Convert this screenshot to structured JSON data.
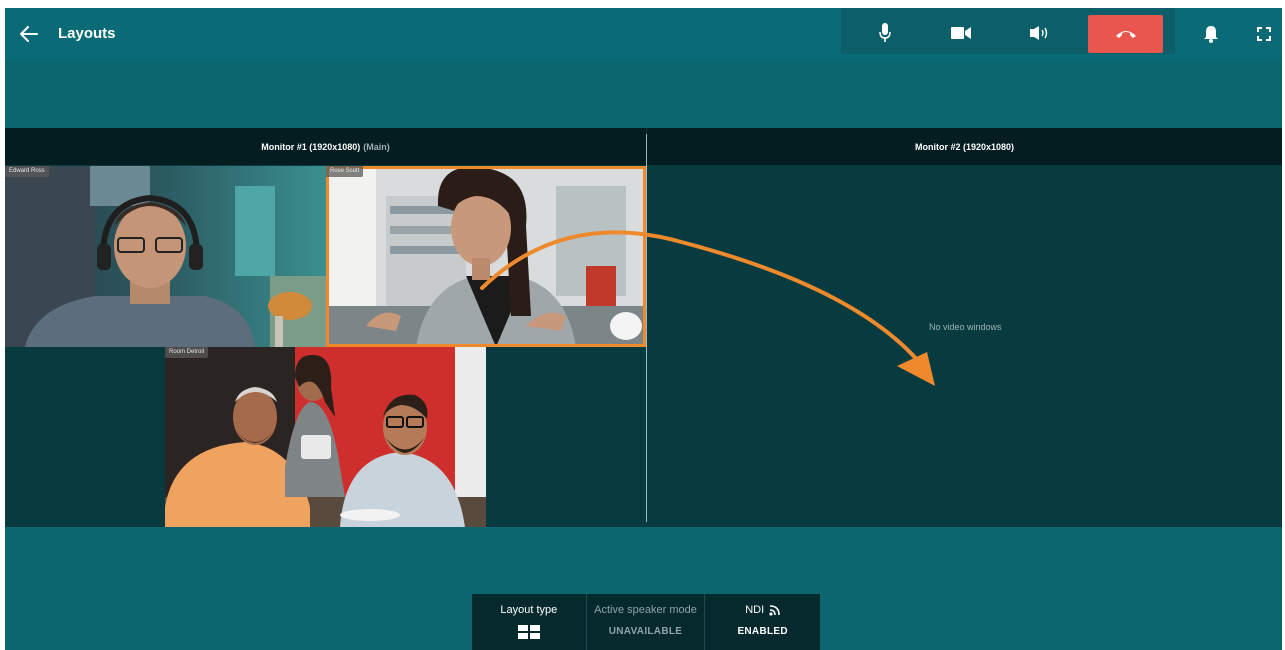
{
  "header": {
    "title": "Layouts",
    "back_icon": "arrow-left-icon"
  },
  "call_controls": {
    "icons": [
      "microphone-icon",
      "camera-icon",
      "speaker-icon",
      "hang-up-icon"
    ],
    "hangup_color": "#e8564e"
  },
  "top_icons": [
    "bell-icon",
    "fullscreen-icon"
  ],
  "monitors": [
    {
      "label": "Monitor #1 (1920x1080)",
      "suffix": "(Main)"
    },
    {
      "label": "Monitor #2 (1920x1080)",
      "suffix": ""
    }
  ],
  "tiles": [
    {
      "name": "Edward Ross"
    },
    {
      "name": "Rose Scott",
      "selected": true
    },
    {
      "name": "Room Detroit"
    }
  ],
  "empty_monitor_text": "No video windows",
  "bottom_bar": {
    "layout_type_label": "Layout type",
    "layout_type_icon": "grid-layout-icon",
    "active_speaker_label": "Active speaker mode",
    "active_speaker_value": "UNAVAILABLE",
    "ndi_label": "NDI",
    "ndi_icon": "rss-feed-icon",
    "ndi_value": "ENABLED"
  },
  "colors": {
    "accent_orange": "#ef8a2c",
    "background": "#0c6670",
    "stage": "#073b40"
  }
}
